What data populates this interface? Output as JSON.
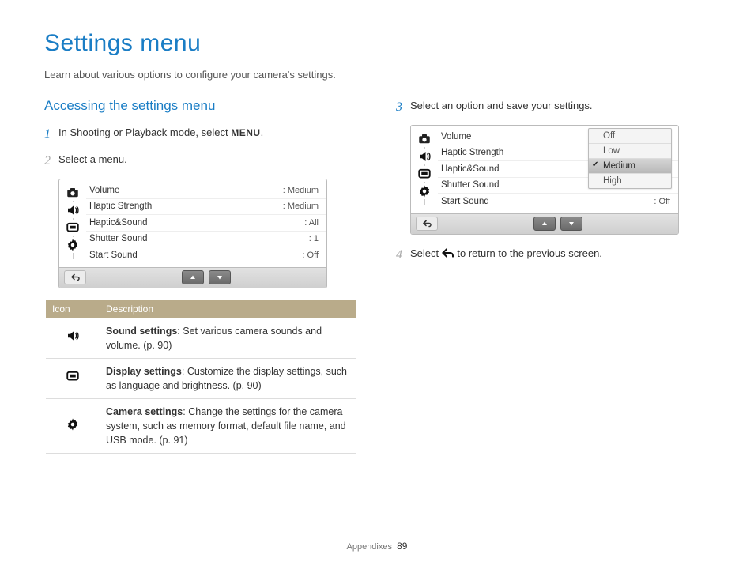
{
  "page": {
    "title": "Settings menu",
    "intro": "Learn about various options to configure your camera's settings."
  },
  "section": {
    "heading": "Accessing the settings menu"
  },
  "steps": {
    "s1": {
      "num": "1",
      "text_before": "In Shooting or Playback mode, select ",
      "menu_label": "MENU",
      "text_after": "."
    },
    "s2": {
      "num": "2",
      "text": "Select a menu."
    },
    "s3": {
      "num": "3",
      "text": "Select an option and save your settings."
    },
    "s4": {
      "num": "4",
      "text_before": "Select ",
      "text_after": " to return to the previous screen."
    }
  },
  "menu_left": {
    "rows": [
      {
        "label": "Volume",
        "value": ": Medium"
      },
      {
        "label": "Haptic Strength",
        "value": ": Medium"
      },
      {
        "label": "Haptic&Sound",
        "value": ": All"
      },
      {
        "label": "Shutter Sound",
        "value": ": 1"
      },
      {
        "label": "Start Sound",
        "value": ": Off"
      }
    ]
  },
  "menu_right": {
    "rows": [
      {
        "label": "Volume",
        "value": ""
      },
      {
        "label": "Haptic Strength",
        "value": ""
      },
      {
        "label": "Haptic&Sound",
        "value": ""
      },
      {
        "label": "Shutter Sound",
        "value": ""
      },
      {
        "label": "Start Sound",
        "value": ": Off"
      }
    ],
    "dropdown": {
      "options": [
        "Off",
        "Low",
        "Medium",
        "High"
      ],
      "selected": "Medium"
    }
  },
  "desc_table": {
    "headers": {
      "icon": "Icon",
      "desc": "Description"
    },
    "rows": [
      {
        "bold": "Sound settings",
        "rest": ": Set various camera sounds and volume. (p. 90)"
      },
      {
        "bold": "Display settings",
        "rest": ": Customize the display settings, such as language and brightness. (p. 90)"
      },
      {
        "bold": "Camera settings",
        "rest": ": Change the settings for the camera system, such as memory format, default file name, and USB mode. (p. 91)"
      }
    ]
  },
  "footer": {
    "section": "Appendixes",
    "page_number": "89"
  }
}
